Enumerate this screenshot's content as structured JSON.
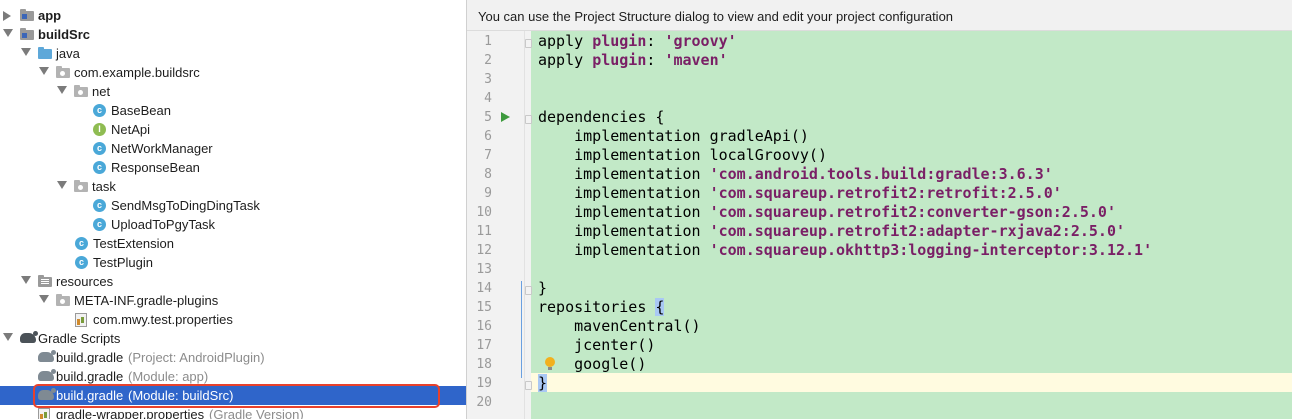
{
  "tree": {
    "rows": [
      {
        "label": "app",
        "bold": true,
        "icon": "module-folder-icon",
        "arrow": "collapsed",
        "hint": ""
      },
      {
        "label": "buildSrc",
        "bold": true,
        "icon": "module-folder-icon",
        "arrow": "expanded",
        "hint": ""
      },
      {
        "label": "java",
        "bold": false,
        "icon": "source-folder-icon",
        "arrow": "expanded",
        "hint": ""
      },
      {
        "label": "com.example.buildsrc",
        "bold": false,
        "icon": "package-icon",
        "arrow": "expanded",
        "hint": ""
      },
      {
        "label": "net",
        "bold": false,
        "icon": "package-icon",
        "arrow": "expanded",
        "hint": ""
      },
      {
        "label": "BaseBean",
        "bold": false,
        "icon": "class-icon",
        "arrow": "",
        "hint": ""
      },
      {
        "label": "NetApi",
        "bold": false,
        "icon": "interface-icon",
        "arrow": "",
        "hint": ""
      },
      {
        "label": "NetWorkManager",
        "bold": false,
        "icon": "class-icon",
        "arrow": "",
        "hint": ""
      },
      {
        "label": "ResponseBean",
        "bold": false,
        "icon": "class-icon",
        "arrow": "",
        "hint": ""
      },
      {
        "label": "task",
        "bold": false,
        "icon": "package-icon",
        "arrow": "expanded",
        "hint": ""
      },
      {
        "label": "SendMsgToDingDingTask",
        "bold": false,
        "icon": "class-icon",
        "arrow": "",
        "hint": ""
      },
      {
        "label": "UploadToPgyTask",
        "bold": false,
        "icon": "class-icon",
        "arrow": "",
        "hint": ""
      },
      {
        "label": "TestExtension",
        "bold": false,
        "icon": "class-icon",
        "arrow": "",
        "hint": ""
      },
      {
        "label": "TestPlugin",
        "bold": false,
        "icon": "class-icon",
        "arrow": "",
        "hint": ""
      },
      {
        "label": "resources",
        "bold": false,
        "icon": "resources-folder-icon",
        "arrow": "expanded",
        "hint": ""
      },
      {
        "label": "META-INF.gradle-plugins",
        "bold": false,
        "icon": "package-icon",
        "arrow": "expanded",
        "hint": ""
      },
      {
        "label": "com.mwy.test.properties",
        "bold": false,
        "icon": "properties-file-icon",
        "arrow": "",
        "hint": ""
      },
      {
        "label": "Gradle Scripts",
        "bold": false,
        "icon": "gradle-icon",
        "arrow": "expanded",
        "hint": ""
      },
      {
        "label": "build.gradle",
        "bold": false,
        "icon": "gradle-file-icon",
        "arrow": "",
        "hint": "(Project: AndroidPlugin)"
      },
      {
        "label": "build.gradle",
        "bold": false,
        "icon": "gradle-file-icon",
        "arrow": "",
        "hint": "(Module: app)"
      },
      {
        "label": "build.gradle",
        "bold": false,
        "icon": "gradle-file-icon",
        "arrow": "",
        "hint": "(Module: buildSrc)",
        "selected": true
      },
      {
        "label": "gradle-wrapper.properties",
        "bold": false,
        "icon": "properties-file-icon",
        "arrow": "",
        "hint": "(Gradle Version)"
      }
    ]
  },
  "editor": {
    "banner": "You can use the Project Structure dialog to view and edit your project configuration",
    "line_numbers": [
      "1",
      "2",
      "3",
      "4",
      "5",
      "6",
      "7",
      "8",
      "9",
      "10",
      "11",
      "12",
      "13",
      "14",
      "15",
      "16",
      "17",
      "18",
      "19",
      "20"
    ],
    "code": [
      [
        {
          "t": "apply "
        },
        {
          "t": "plugin",
          "c": "kw"
        },
        {
          "t": ": "
        },
        {
          "t": "'groovy'",
          "c": "str"
        }
      ],
      [
        {
          "t": "apply "
        },
        {
          "t": "plugin",
          "c": "kw"
        },
        {
          "t": ": "
        },
        {
          "t": "'maven'",
          "c": "str"
        }
      ],
      [],
      [],
      [
        {
          "t": "dependencies {"
        }
      ],
      [
        {
          "t": "    implementation gradleApi()"
        }
      ],
      [
        {
          "t": "    implementation localGroovy()"
        }
      ],
      [
        {
          "t": "    implementation "
        },
        {
          "t": "'com.android.tools.build:gradle:3.6.3'",
          "c": "str"
        }
      ],
      [
        {
          "t": "    implementation "
        },
        {
          "t": "'com.squareup.retrofit2:retrofit:2.5.0'",
          "c": "str"
        }
      ],
      [
        {
          "t": "    implementation "
        },
        {
          "t": "'com.squareup.retrofit2:converter-gson:2.5.0'",
          "c": "str"
        }
      ],
      [
        {
          "t": "    implementation "
        },
        {
          "t": "'com.squareup.retrofit2:adapter-rxjava2:2.5.0'",
          "c": "str"
        }
      ],
      [
        {
          "t": "    implementation "
        },
        {
          "t": "'com.squareup.okhttp3:logging-interceptor:3.12.1'",
          "c": "str"
        }
      ],
      [],
      [
        {
          "t": "}"
        }
      ],
      [
        {
          "t": "repositories "
        },
        {
          "t": "{",
          "c": "brace"
        }
      ],
      [
        {
          "t": "    mavenCentral()"
        }
      ],
      [
        {
          "t": "    jcenter()"
        }
      ],
      [
        {
          "t": "    google()"
        }
      ],
      [
        {
          "t": "}",
          "c": "brace"
        }
      ],
      []
    ]
  }
}
